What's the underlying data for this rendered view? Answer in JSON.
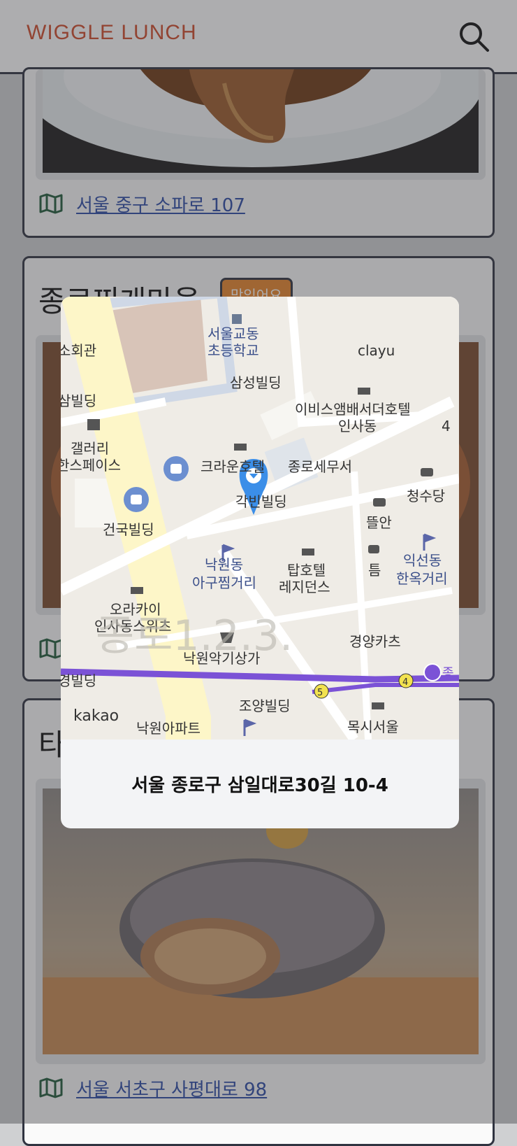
{
  "header": {
    "logo": "WIGGLE LUNCH"
  },
  "cards": [
    {
      "address": "서울 중구 소파로 107"
    },
    {
      "title": "종로찌개마을",
      "badge": "맛있어요",
      "address": ""
    },
    {
      "title": "타",
      "address": "서울 서초구 사평대로 98"
    }
  ],
  "modal": {
    "address": "서울 종로구 삼일대로30길 10-4",
    "map_labels": {
      "school": "서울교동",
      "school2": "초등학교",
      "samsung": "삼성빌딩",
      "clayu": "clayu",
      "ibis": "이비스앰배서더호텔",
      "ibis2": "인사동",
      "crown": "크라운호텔",
      "tax": "종로세무서",
      "gakbin": "각빈빌딩",
      "gallery": "갤러리",
      "gallery2": "한스페이스",
      "geonguk": "건국빌딩",
      "nakwon": "낙원동",
      "nakwon2": "아구찜거리",
      "tap": "탑호텔",
      "tap2": "레지던스",
      "orakai": "오라카이",
      "orakai2": "인사동스위츠",
      "music": "낙원악기상가",
      "gyeongyang": "경양카츠",
      "josyang": "조양빌딩",
      "moksi": "목시서울",
      "apt": "낙원아파트",
      "kakao": "kakao",
      "cheongsu": "청수당",
      "tteulan": "뜰안",
      "teum": "틈",
      "iksun": "익선동",
      "iksun2": "한옥거리",
      "jongno_big": "종로1.2.3.",
      "hall": "소회관",
      "bldg_left": "삼빌딩",
      "bldg_left2": "경빌딩",
      "line5": "5",
      "line4": "4",
      "jong": "종",
      "num4": "4"
    }
  }
}
